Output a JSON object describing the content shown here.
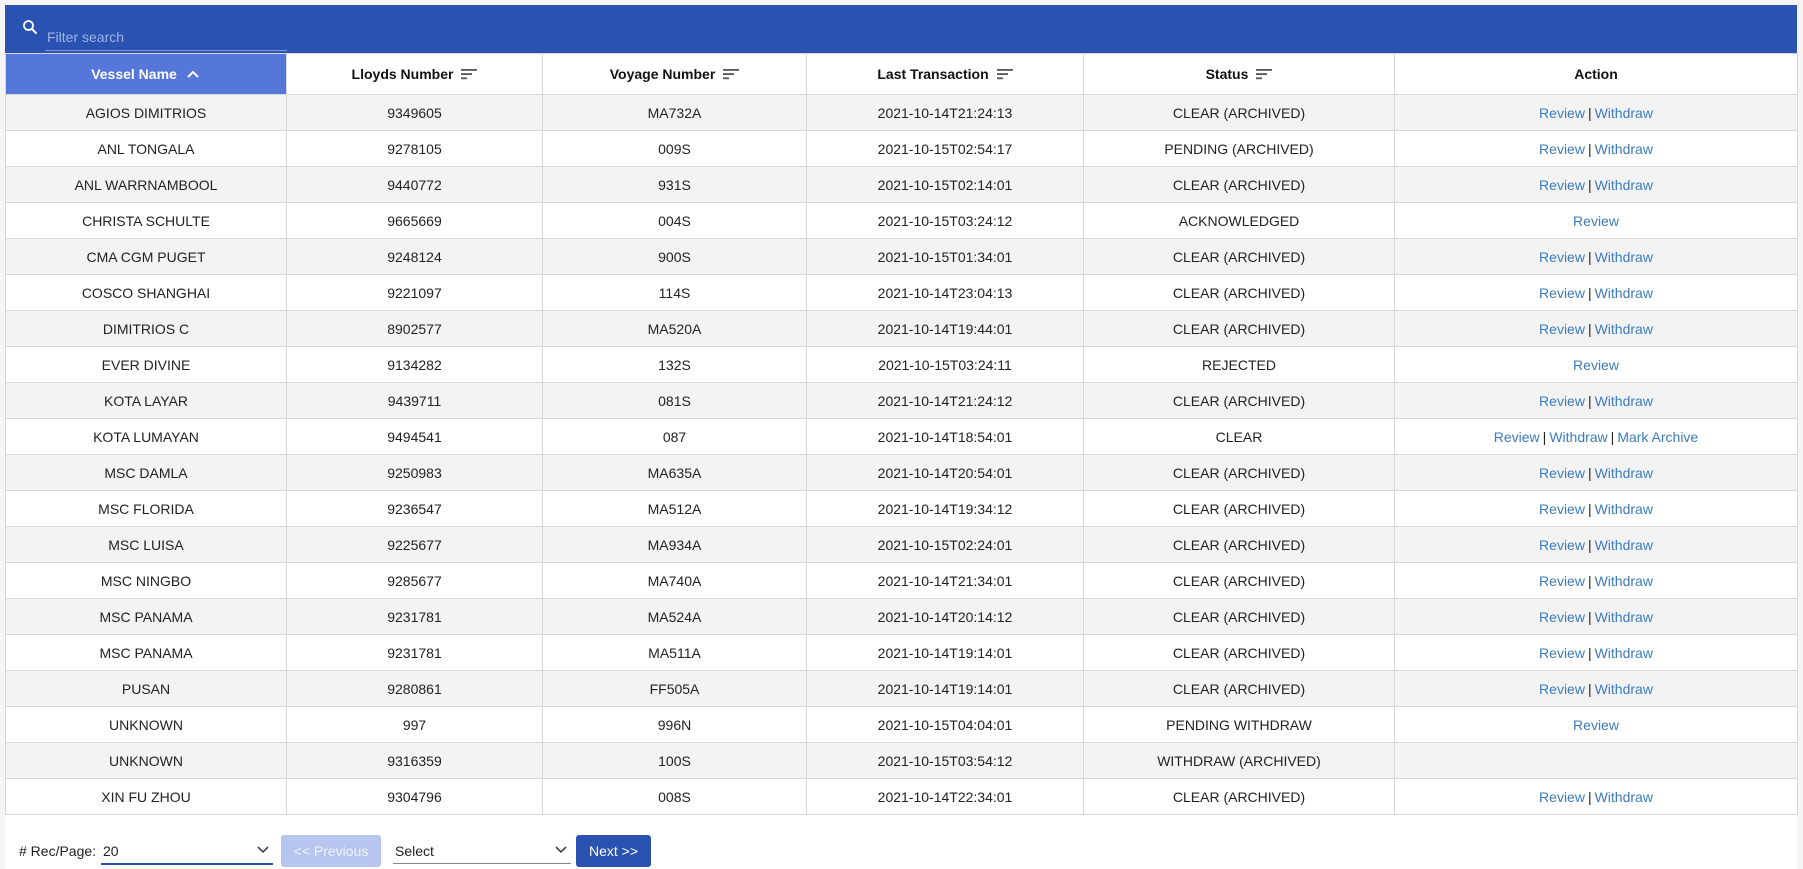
{
  "search": {
    "placeholder": "Filter search"
  },
  "columns": [
    {
      "label": "Vessel Name",
      "sort": "asc"
    },
    {
      "label": "Lloyds Number",
      "sort": "none"
    },
    {
      "label": "Voyage Number",
      "sort": "none"
    },
    {
      "label": "Last Transaction",
      "sort": "none"
    },
    {
      "label": "Status",
      "sort": "none"
    },
    {
      "label": "Action",
      "sort": ""
    }
  ],
  "rows": [
    {
      "vessel": "AGIOS DIMITRIOS",
      "lloyds": "9349605",
      "voyage": "MA732A",
      "last": "2021-10-14T21:24:13",
      "status": "CLEAR (ARCHIVED)",
      "actions": [
        "Review",
        "Withdraw"
      ]
    },
    {
      "vessel": "ANL TONGALA",
      "lloyds": "9278105",
      "voyage": "009S",
      "last": "2021-10-15T02:54:17",
      "status": "PENDING (ARCHIVED)",
      "actions": [
        "Review",
        "Withdraw"
      ]
    },
    {
      "vessel": "ANL WARRNAMBOOL",
      "lloyds": "9440772",
      "voyage": "931S",
      "last": "2021-10-15T02:14:01",
      "status": "CLEAR (ARCHIVED)",
      "actions": [
        "Review",
        "Withdraw"
      ]
    },
    {
      "vessel": "CHRISTA SCHULTE",
      "lloyds": "9665669",
      "voyage": "004S",
      "last": "2021-10-15T03:24:12",
      "status": "ACKNOWLEDGED",
      "actions": [
        "Review"
      ]
    },
    {
      "vessel": "CMA CGM PUGET",
      "lloyds": "9248124",
      "voyage": "900S",
      "last": "2021-10-15T01:34:01",
      "status": "CLEAR (ARCHIVED)",
      "actions": [
        "Review",
        "Withdraw"
      ]
    },
    {
      "vessel": "COSCO SHANGHAI",
      "lloyds": "9221097",
      "voyage": "114S",
      "last": "2021-10-14T23:04:13",
      "status": "CLEAR (ARCHIVED)",
      "actions": [
        "Review",
        "Withdraw"
      ]
    },
    {
      "vessel": "DIMITRIOS C",
      "lloyds": "8902577",
      "voyage": "MA520A",
      "last": "2021-10-14T19:44:01",
      "status": "CLEAR (ARCHIVED)",
      "actions": [
        "Review",
        "Withdraw"
      ]
    },
    {
      "vessel": "EVER DIVINE",
      "lloyds": "9134282",
      "voyage": "132S",
      "last": "2021-10-15T03:24:11",
      "status": "REJECTED",
      "actions": [
        "Review"
      ]
    },
    {
      "vessel": "KOTA LAYAR",
      "lloyds": "9439711",
      "voyage": "081S",
      "last": "2021-10-14T21:24:12",
      "status": "CLEAR (ARCHIVED)",
      "actions": [
        "Review",
        "Withdraw"
      ]
    },
    {
      "vessel": "KOTA LUMAYAN",
      "lloyds": "9494541",
      "voyage": "087",
      "last": "2021-10-14T18:54:01",
      "status": "CLEAR",
      "actions": [
        "Review",
        "Withdraw",
        "Mark Archive"
      ]
    },
    {
      "vessel": "MSC DAMLA",
      "lloyds": "9250983",
      "voyage": "MA635A",
      "last": "2021-10-14T20:54:01",
      "status": "CLEAR (ARCHIVED)",
      "actions": [
        "Review",
        "Withdraw"
      ]
    },
    {
      "vessel": "MSC FLORIDA",
      "lloyds": "9236547",
      "voyage": "MA512A",
      "last": "2021-10-14T19:34:12",
      "status": "CLEAR (ARCHIVED)",
      "actions": [
        "Review",
        "Withdraw"
      ]
    },
    {
      "vessel": "MSC LUISA",
      "lloyds": "9225677",
      "voyage": "MA934A",
      "last": "2021-10-15T02:24:01",
      "status": "CLEAR (ARCHIVED)",
      "actions": [
        "Review",
        "Withdraw"
      ]
    },
    {
      "vessel": "MSC NINGBO",
      "lloyds": "9285677",
      "voyage": "MA740A",
      "last": "2021-10-14T21:34:01",
      "status": "CLEAR (ARCHIVED)",
      "actions": [
        "Review",
        "Withdraw"
      ]
    },
    {
      "vessel": "MSC PANAMA",
      "lloyds": "9231781",
      "voyage": "MA524A",
      "last": "2021-10-14T20:14:12",
      "status": "CLEAR (ARCHIVED)",
      "actions": [
        "Review",
        "Withdraw"
      ]
    },
    {
      "vessel": "MSC PANAMA",
      "lloyds": "9231781",
      "voyage": "MA511A",
      "last": "2021-10-14T19:14:01",
      "status": "CLEAR (ARCHIVED)",
      "actions": [
        "Review",
        "Withdraw"
      ]
    },
    {
      "vessel": "PUSAN",
      "lloyds": "9280861",
      "voyage": "FF505A",
      "last": "2021-10-14T19:14:01",
      "status": "CLEAR (ARCHIVED)",
      "actions": [
        "Review",
        "Withdraw"
      ]
    },
    {
      "vessel": "UNKNOWN",
      "lloyds": "997",
      "voyage": "996N",
      "last": "2021-10-15T04:04:01",
      "status": "PENDING WITHDRAW",
      "actions": [
        "Review"
      ]
    },
    {
      "vessel": "UNKNOWN",
      "lloyds": "9316359",
      "voyage": "100S",
      "last": "2021-10-15T03:54:12",
      "status": "WITHDRAW (ARCHIVED)",
      "actions": []
    },
    {
      "vessel": "XIN FU ZHOU",
      "lloyds": "9304796",
      "voyage": "008S",
      "last": "2021-10-14T22:34:01",
      "status": "CLEAR (ARCHIVED)",
      "actions": [
        "Review",
        "Withdraw"
      ]
    }
  ],
  "footer": {
    "rec_label": "# Rec/Page:",
    "rec_value": "20",
    "prev_label": "<< Previous",
    "select_value": "Select",
    "next_label": "Next >>"
  },
  "colors": {
    "header_bar": "#2a52b0",
    "active_header": "#5677da",
    "link": "#3b7bbf"
  }
}
